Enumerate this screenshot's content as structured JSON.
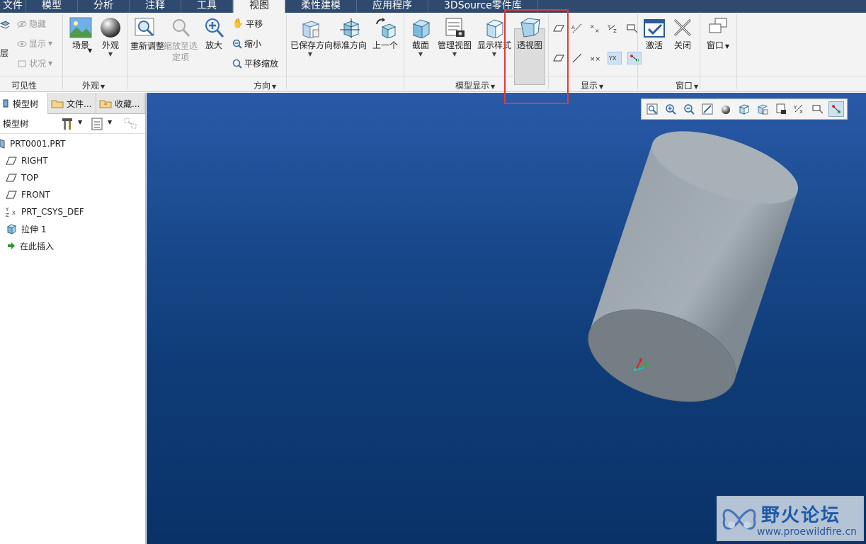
{
  "tabs": [
    "文件",
    "模型",
    "分析",
    "注释",
    "工具",
    "视图",
    "柔性建模",
    "应用程序",
    "3DSource零件库"
  ],
  "active_tab": "视图",
  "ribbon": {
    "visibility": {
      "hide": "隐藏",
      "show": "显示",
      "status": "状况",
      "layer": "层",
      "group": "可见性"
    },
    "appearance": {
      "scene": "场景",
      "appearance": "外观",
      "group": "外观"
    },
    "orientation": {
      "refit": "重新调整",
      "zoom_selected": "缩放至选定项",
      "zoom_in": "放大",
      "pan": "平移",
      "zoom_out": "缩小",
      "pan_zoom": "平移缩放",
      "saved_orient": "已保存方向",
      "standard_orient": "标准方向",
      "previous": "上一个",
      "group": "方向"
    },
    "model_display": {
      "section": "截面",
      "manage_views": "管理视图",
      "display_style": "显示样式",
      "perspective": "透视图",
      "group": "模型显示"
    },
    "display": {
      "group": "显示"
    },
    "window": {
      "activate": "激活",
      "close": "关闭",
      "window": "窗口",
      "group": "窗口"
    }
  },
  "panel": {
    "tabs": [
      "模型树",
      "文件...",
      "收藏..."
    ],
    "toolbar_label": "模型树",
    "tree": [
      {
        "label": "PRT0001.PRT",
        "icon": "part-icon"
      },
      {
        "label": "RIGHT",
        "icon": "datum-plane-icon"
      },
      {
        "label": "TOP",
        "icon": "datum-plane-icon"
      },
      {
        "label": "FRONT",
        "icon": "datum-plane-icon"
      },
      {
        "label": "PRT_CSYS_DEF",
        "icon": "csys-icon"
      },
      {
        "label": "拉伸 1",
        "icon": "extrude-icon"
      },
      {
        "label": "在此插入",
        "icon": "insert-arrow-icon"
      }
    ]
  },
  "watermark": {
    "title": "野火论坛",
    "url": "www.proewildfire.cn"
  },
  "colors": {
    "tabbar": "#2f4a6e",
    "highlight_box": "#e53935",
    "viewport_top": "#2a5aa8",
    "viewport_bottom": "#0a3268"
  }
}
